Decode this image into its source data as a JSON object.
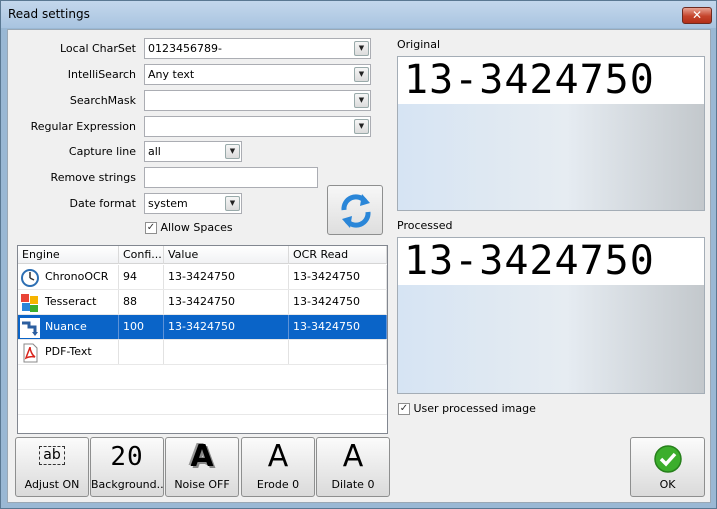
{
  "window": {
    "title": "Read settings",
    "close_label": "✕"
  },
  "form": {
    "local_charset": {
      "label": "Local CharSet",
      "value": "0123456789-"
    },
    "intellisearch": {
      "label": "IntelliSearch",
      "value": "Any text"
    },
    "searchmask": {
      "label": "SearchMask",
      "value": ""
    },
    "regex": {
      "label": "Regular Expression",
      "value": ""
    },
    "capture_line": {
      "label": "Capture line",
      "value": "all"
    },
    "remove_strings": {
      "label": "Remove strings",
      "value": ""
    },
    "date_format": {
      "label": "Date format",
      "value": "system"
    },
    "allow_spaces": {
      "label": "Allow Spaces",
      "checked": true
    }
  },
  "grid": {
    "columns": [
      "Engine",
      "Confi...",
      "Value",
      "OCR Read"
    ],
    "rows": [
      {
        "engine": "ChronoOCR",
        "icon": "chronoocr-icon",
        "confidence": "94",
        "value": "13-3424750",
        "ocr_read": "13-3424750",
        "selected": false
      },
      {
        "engine": "Tesseract",
        "icon": "tesseract-icon",
        "confidence": "88",
        "value": "13-3424750",
        "ocr_read": "13-3424750",
        "selected": false
      },
      {
        "engine": "Nuance",
        "icon": "nuance-icon",
        "confidence": "100",
        "value": "13-3424750",
        "ocr_read": "13-3424750",
        "selected": true
      },
      {
        "engine": "PDF-Text",
        "icon": "pdf-icon",
        "confidence": "",
        "value": "",
        "ocr_read": "",
        "selected": false
      }
    ]
  },
  "toolbar": {
    "adjust": {
      "label": "Adjust ON",
      "glyph": "ab"
    },
    "background": {
      "label": "Background...",
      "glyph": "20"
    },
    "noise": {
      "label": "Noise OFF",
      "glyph": "A"
    },
    "erode": {
      "label": "Erode 0",
      "glyph": "A"
    },
    "dilate": {
      "label": "Dilate 0",
      "glyph": "A"
    },
    "ok": {
      "label": "OK"
    }
  },
  "preview": {
    "original_label": "Original",
    "original_text": "13-3424750",
    "processed_label": "Processed",
    "processed_text": "13-3424750",
    "user_processed": {
      "label": "User processed image",
      "checked": true
    }
  },
  "colors": {
    "selection": "#0a64c8",
    "titlebar": "#a9c4e0",
    "ok_green": "#3cae2c",
    "refresh_blue": "#2a86d8"
  }
}
